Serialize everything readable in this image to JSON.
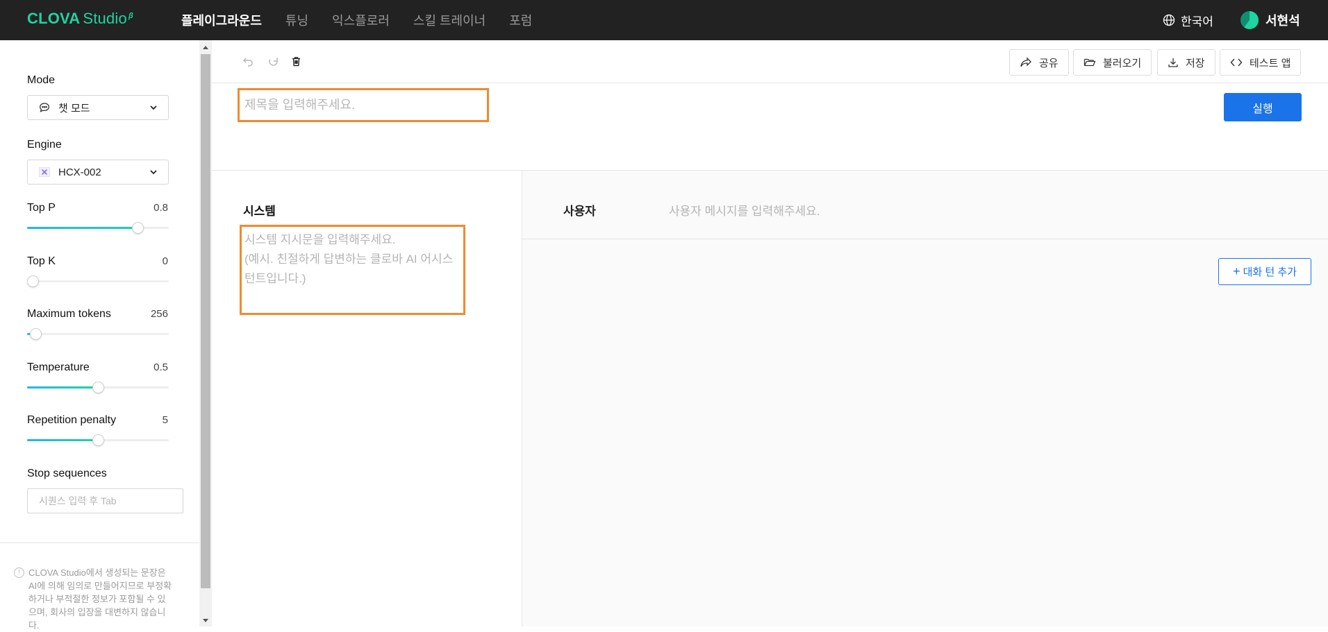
{
  "brand": {
    "name": "CLOVA",
    "suffix": "Studio",
    "sup": "β"
  },
  "nav": [
    {
      "label": "플레이그라운드",
      "active": true
    },
    {
      "label": "튜닝",
      "active": false
    },
    {
      "label": "익스플로러",
      "active": false
    },
    {
      "label": "스킬 트레이너",
      "active": false
    },
    {
      "label": "포럼",
      "active": false
    }
  ],
  "header": {
    "language": "한국어",
    "user_name": "서현석"
  },
  "sidebar": {
    "mode": {
      "label": "Mode",
      "value": "챗 모드"
    },
    "engine": {
      "label": "Engine",
      "value": "HCX-002"
    },
    "params": [
      {
        "label": "Top P",
        "value": "0.8",
        "level": 0.78
      },
      {
        "label": "Top K",
        "value": "0",
        "level": 0.0
      },
      {
        "label": "Maximum tokens",
        "value": "256",
        "level": 0.06
      },
      {
        "label": "Temperature",
        "value": "0.5",
        "level": 0.5
      },
      {
        "label": "Repetition penalty",
        "value": "5",
        "level": 0.5
      }
    ],
    "stop": {
      "label": "Stop sequences",
      "placeholder": "시퀀스 입력 후 Tab"
    },
    "notice": "CLOVA Studio에서 생성되는 문장은 AI에 의해 임의로 만들어지므로 부정확하거나 부적절한 정보가 포함될 수 있으며, 회사의 입장을 대변하지 않습니다."
  },
  "toolbar": {
    "share": "공유",
    "load": "불러오기",
    "save": "저장",
    "test_app": "테스트 앱"
  },
  "main": {
    "title_placeholder": "제목을 입력해주세요.",
    "run": "실행",
    "system_title": "시스템",
    "system_placeholder": "시스템 지시문을 입력해주세요.\n(예시. 친절하게 답변하는 클로바 AI 어시스턴트입니다.)",
    "user_label": "사용자",
    "user_placeholder": "사용자 메시지를 입력해주세요.",
    "add_turn": "대화 턴 추가"
  }
}
